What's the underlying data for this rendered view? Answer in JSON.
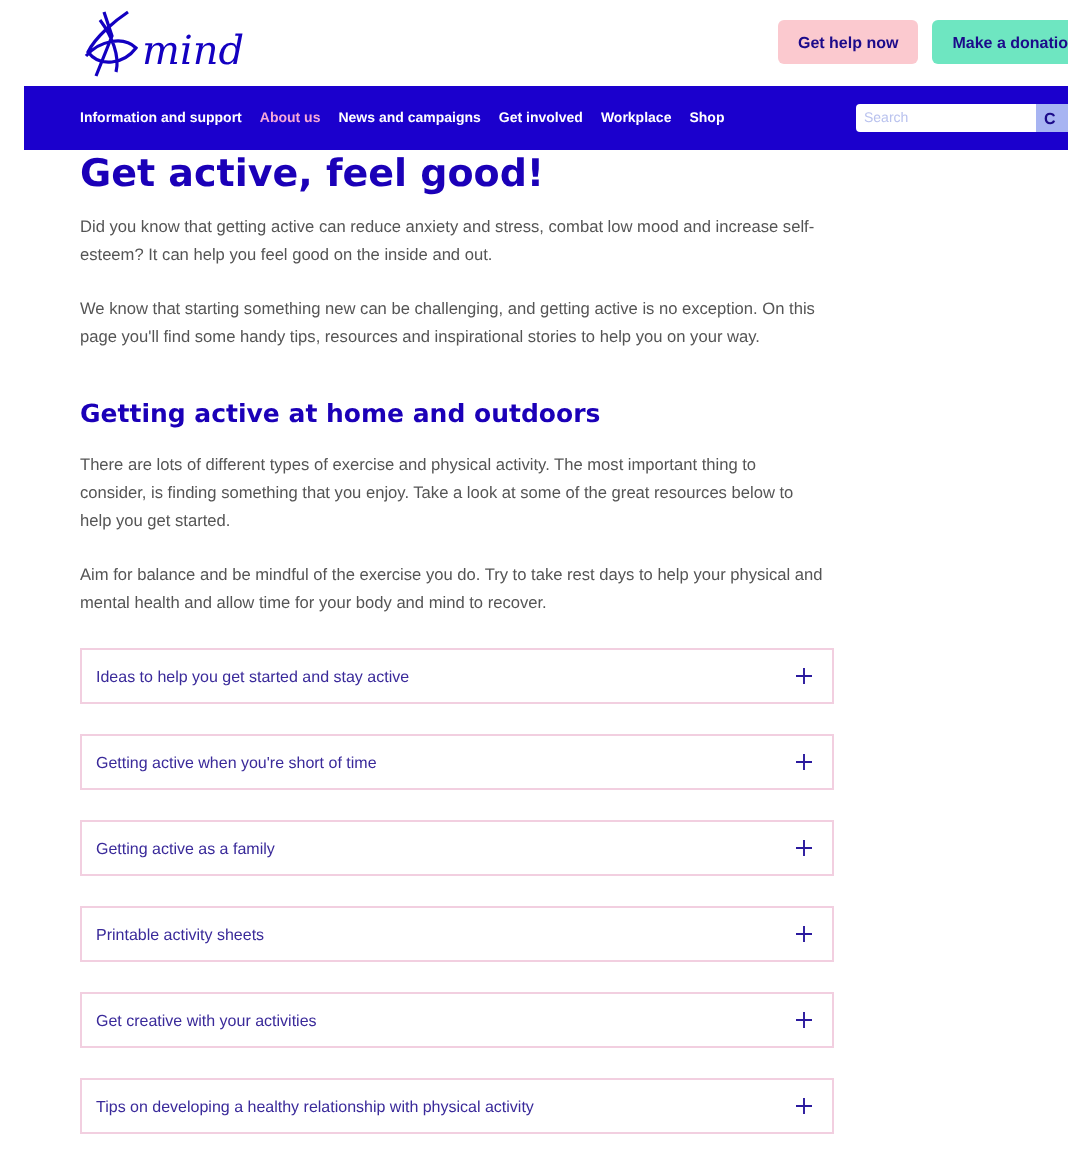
{
  "header": {
    "logo": "mind",
    "buttons": [
      {
        "label": "Get help now",
        "kind": "help"
      },
      {
        "label": "Make a donatio",
        "kind": "donate"
      }
    ]
  },
  "nav": {
    "items": [
      {
        "label": "Information and support",
        "selected": false
      },
      {
        "label": "About us",
        "selected": true
      },
      {
        "label": "News and campaigns",
        "selected": false
      },
      {
        "label": "Get involved",
        "selected": false
      },
      {
        "label": "Workplace",
        "selected": false
      },
      {
        "label": "Shop",
        "selected": false
      }
    ],
    "search": {
      "placeholder": "Search",
      "button": "C"
    }
  },
  "title": "Get active, feel good!",
  "intro": [
    "Did you know that getting active can reduce anxiety and stress, combat low mood and increase self-esteem? It can help you feel good on the inside and out.",
    "We know that starting something new can be challenging, and getting active is no exception. On this page you'll find some handy tips, resources and inspirational stories to help you on your way."
  ],
  "section": {
    "heading": "Getting active at home and outdoors",
    "paragraphs": [
      "There are lots of different types of exercise and physical activity. The most important thing to consider, is finding something that you enjoy. Take a look at some of the great resources below to help you get started.",
      "Aim for balance and be mindful of the exercise you do.  Try to take rest days to help your physical and mental health and allow time for your body and mind to recover."
    ],
    "accordions": [
      {
        "label": "Ideas to help you get started and stay active",
        "expanded": false
      },
      {
        "label": "Getting active when you're short of time",
        "expanded": false
      },
      {
        "label": "Getting active as a family",
        "expanded": false
      },
      {
        "label": "Printable activity sheets",
        "expanded": false
      },
      {
        "label": "Get creative with your activities",
        "expanded": false
      },
      {
        "label": "Tips on developing a healthy relationship with physical activity",
        "expanded": false
      }
    ]
  }
}
